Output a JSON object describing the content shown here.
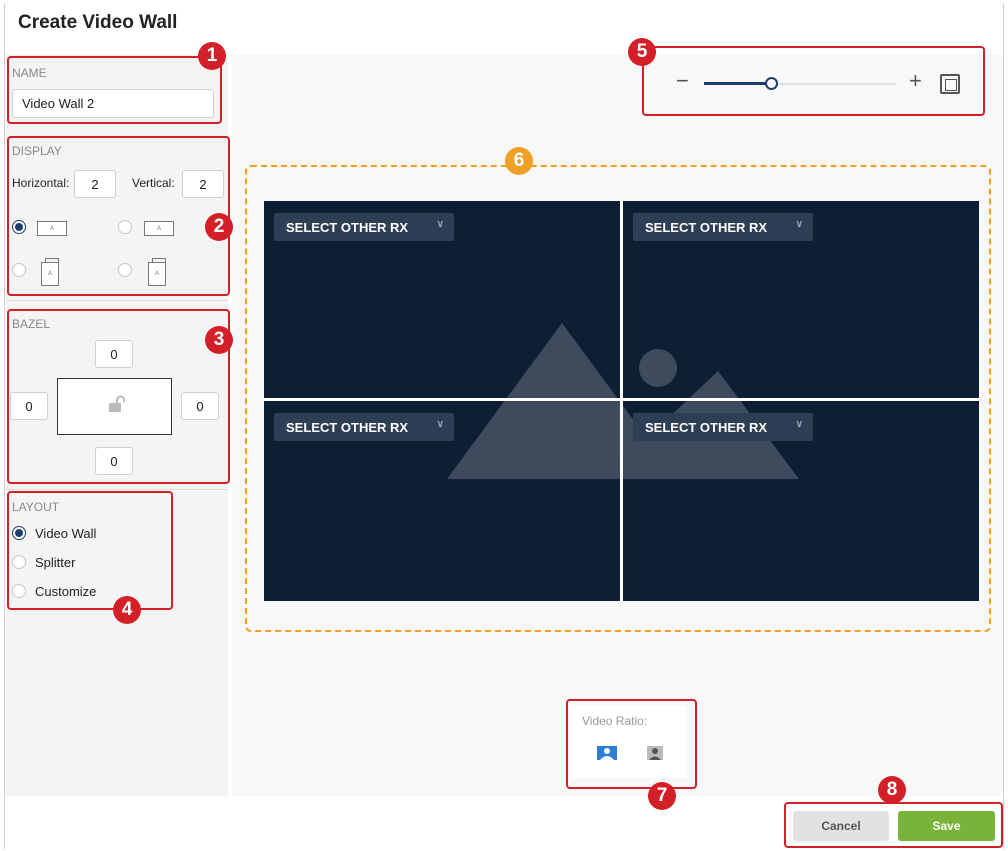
{
  "dialog": {
    "title": "Create Video Wall"
  },
  "name_section": {
    "label": "NAME",
    "value": "Video Wall 2"
  },
  "display_section": {
    "label": "DISPLAY",
    "horizontal_label": "Horizontal:",
    "horizontal_value": "2",
    "vertical_label": "Vertical:",
    "vertical_value": "2",
    "orientations": [
      {
        "icon": "landscape-icon",
        "glyph": "A",
        "selected": true
      },
      {
        "icon": "landscape-flipped-icon",
        "glyph": "A",
        "selected": false
      },
      {
        "icon": "portrait-icon",
        "glyph": "A",
        "selected": false
      },
      {
        "icon": "portrait-flipped-icon",
        "glyph": "A",
        "selected": false
      }
    ]
  },
  "bezel_section": {
    "label": "BAZEL",
    "top": "0",
    "left": "0",
    "right": "0",
    "bottom": "0",
    "lock_icon": "unlock-icon"
  },
  "layout_section": {
    "label": "LAYOUT",
    "options": [
      {
        "label": "Video Wall",
        "selected": true
      },
      {
        "label": "Splitter",
        "selected": false
      },
      {
        "label": "Customize",
        "selected": false
      }
    ]
  },
  "zoom": {
    "level": 0.35,
    "minus_icon": "minus-icon",
    "plus_icon": "plus-icon",
    "fit_icon": "fit-screen-icon"
  },
  "wall": {
    "rows": 2,
    "cols": 2,
    "cells": [
      {
        "select_label": "SELECT OTHER RX"
      },
      {
        "select_label": "SELECT OTHER RX"
      },
      {
        "select_label": "SELECT OTHER RX"
      },
      {
        "select_label": "SELECT OTHER RX"
      }
    ],
    "background_icon": "image-placeholder-icon",
    "background_color": "#0e1e33"
  },
  "video_ratio": {
    "label": "Video Ratio:",
    "options": [
      {
        "icon": "ratio-fill-icon",
        "selected": true
      },
      {
        "icon": "ratio-keep-icon",
        "selected": false
      }
    ]
  },
  "footer": {
    "cancel_label": "Cancel",
    "save_label": "Save"
  },
  "annotations": [
    "1",
    "2",
    "3",
    "4",
    "5",
    "6",
    "7",
    "8"
  ],
  "colors": {
    "accent": "#1a3e6e",
    "annotation_red": "#d32028",
    "annotation_orange": "#f0a024",
    "save_green": "#79b33a"
  }
}
